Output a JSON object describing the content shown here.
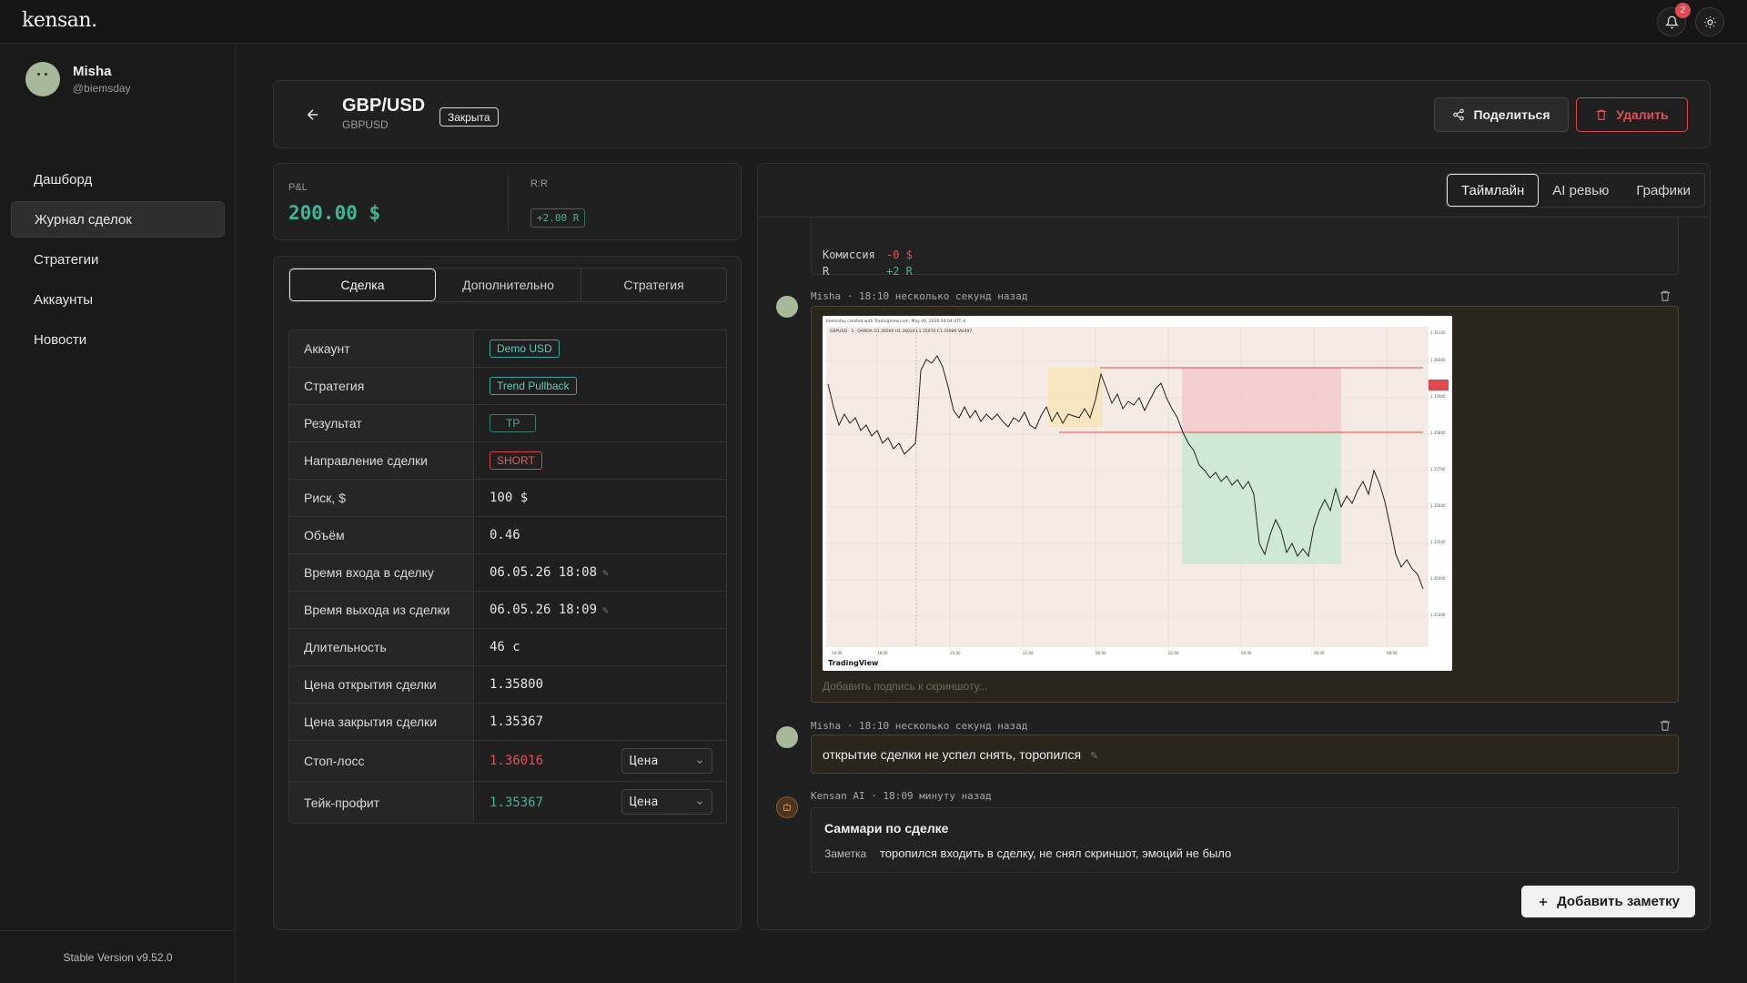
{
  "app": {
    "logo": "kensan.",
    "notifications_count": "2"
  },
  "user": {
    "name": "Misha",
    "handle": "@biemsday"
  },
  "nav": [
    {
      "label": "Дашборд",
      "active": false
    },
    {
      "label": "Журнал сделок",
      "active": true
    },
    {
      "label": "Стратегии",
      "active": false
    },
    {
      "label": "Аккаунты",
      "active": false
    },
    {
      "label": "Новости",
      "active": false
    }
  ],
  "version": "Stable Version v9.52.0",
  "trade": {
    "pair": "GBP/USD",
    "symbol": "GBPUSD",
    "status": "Закрыта",
    "share_label": "Поделиться",
    "delete_label": "Удалить"
  },
  "pnl": {
    "label": "P&L",
    "value": "200.00 $",
    "rr_label": "R:R",
    "rr_value": "+2.00 R"
  },
  "detail_tabs": [
    "Сделка",
    "Дополнительно",
    "Стратегия"
  ],
  "details": {
    "account": {
      "label": "Аккаунт",
      "value": "Demo USD"
    },
    "strategy": {
      "label": "Стратегия",
      "value": "Trend Pullback"
    },
    "result": {
      "label": "Результат",
      "value": "TP"
    },
    "direction": {
      "label": "Направление сделки",
      "value": "SHORT"
    },
    "risk": {
      "label": "Риск, $",
      "value": "100 $"
    },
    "volume": {
      "label": "Объём",
      "value": "0.46"
    },
    "entry_time": {
      "label": "Время входа в сделку",
      "value": "06.05.26 18:08"
    },
    "exit_time": {
      "label": "Время выхода из сделки",
      "value": "06.05.26 18:09"
    },
    "duration": {
      "label": "Длительность",
      "value": "46 с"
    },
    "open_price": {
      "label": "Цена открытия сделки",
      "value": "1.35800"
    },
    "close_price": {
      "label": "Цена закрытия сделки",
      "value": "1.35367"
    },
    "stop_loss": {
      "label": "Стоп-лосс",
      "value": "1.36016",
      "mode": "Цена"
    },
    "take_profit": {
      "label": "Тейк-профит",
      "value": "1.35367",
      "mode": "Цена"
    }
  },
  "timeline_tabs": [
    "Таймлайн",
    "AI ревью",
    "Графики"
  ],
  "timeline": {
    "summary_rows": [
      {
        "key": "Комиссия",
        "value": "-0 $"
      },
      {
        "key": "R",
        "value": "+2 R"
      }
    ],
    "screenshot_entry": {
      "meta": "Misha · 18:10 несколько секунд назад",
      "caption_placeholder": "Добавить подпись к скриншоту...",
      "chart_header": "biemsday created with TradingView.com, May 06, 2026 04:04 UTC-4",
      "chart_legend": "GBPUSD · 3 · OANDA  O1.36000 H1.36024 L1.35970 C1.35980 Vol497",
      "chart_brand": "TradingView"
    },
    "note_entry": {
      "meta": "Misha · 18:10 несколько секунд назад",
      "text": "открытие сделки не успел снять, торопился"
    },
    "ai_entry": {
      "meta": "Kensan AI · 18:09 минуту назад",
      "title": "Саммари по сделке",
      "note_key": "Заметка",
      "note_value": "торопился входить в сделку, не снял скриншот, эмоций не было"
    },
    "add_note_label": "Добавить заметку"
  },
  "colors": {
    "profit": "#3fb59a",
    "loss": "#e25158",
    "accent_border": "#4a4233"
  }
}
